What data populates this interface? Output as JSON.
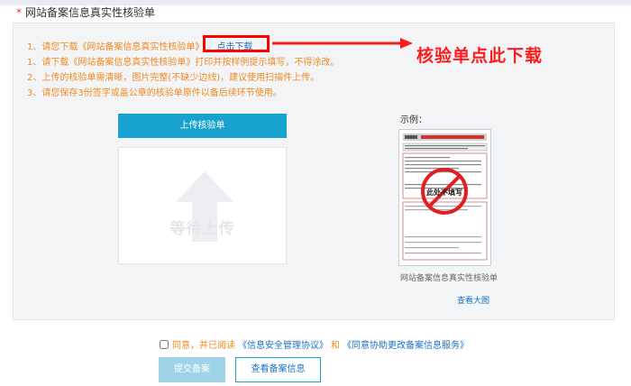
{
  "section": {
    "star": "*",
    "title": "网站备案信息真实性核验单"
  },
  "steps": [
    {
      "prefix": "1、请您下载《网站备案信息真实性核验单》",
      "link": "点击下载"
    },
    {
      "text": "1、请下载《网站备案信息真实性核验单》打印并按样例提示填写，不得涂改。"
    },
    {
      "text": "2、上传的核验单需清晰，图片完整(不缺少边线)，建议使用扫描件上传。"
    },
    {
      "text": "3、请您保存3份签字或盖公章的核验单原件以备后续环节使用。"
    }
  ],
  "annotation": {
    "callout": "核验单点此下载",
    "color": "#ff1b1b"
  },
  "upload": {
    "button": "上传核验单",
    "placeholder": "等待上传"
  },
  "example": {
    "label": "示例：",
    "caption": "网站备案信息真实性核验单",
    "view_large": "查看大图",
    "stamp_text": "此处不填写"
  },
  "agreement": {
    "text": "同意，并已阅读",
    "link1": "《信息安全管理协议》",
    "and": "和",
    "link2": "《同意协助更改备案信息服务》"
  },
  "buttons": {
    "submit": "提交备案",
    "view": "查看备案信息"
  },
  "colors": {
    "accent": "#18a2cf",
    "orange": "#f08a24",
    "link": "#1b72c4"
  }
}
